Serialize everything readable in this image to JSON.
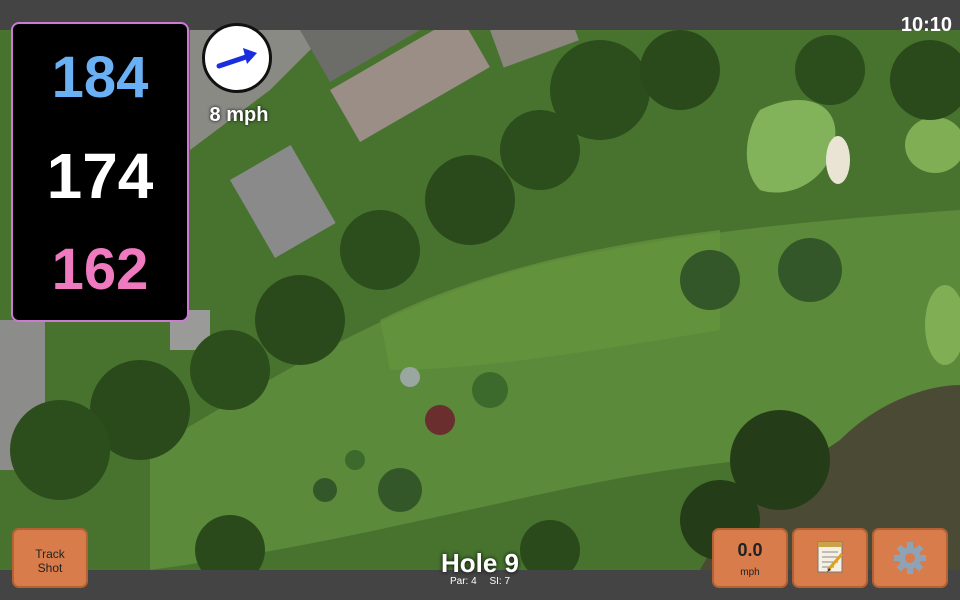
{
  "status": {
    "time": "10:10"
  },
  "distances": {
    "back": "184",
    "middle": "174",
    "front": "162"
  },
  "wind": {
    "speed": "8 mph",
    "direction_icon": "arrow-right-icon",
    "arrow_color": "#1a2ee0"
  },
  "hole": {
    "title": "Hole 9",
    "par": "Par: 4",
    "si": "SI: 7"
  },
  "buttons": {
    "track_shot": "Track\nShot",
    "speed_value": "0.0",
    "speed_unit": "mph",
    "notes_icon": "notepad-icon",
    "settings_icon": "gear-icon"
  },
  "colors": {
    "back_distance": "#6ab0f5",
    "middle_distance": "#ffffff",
    "front_distance": "#f07ac0",
    "panel_border": "#cc7ad4",
    "button": "#d97c4b"
  }
}
